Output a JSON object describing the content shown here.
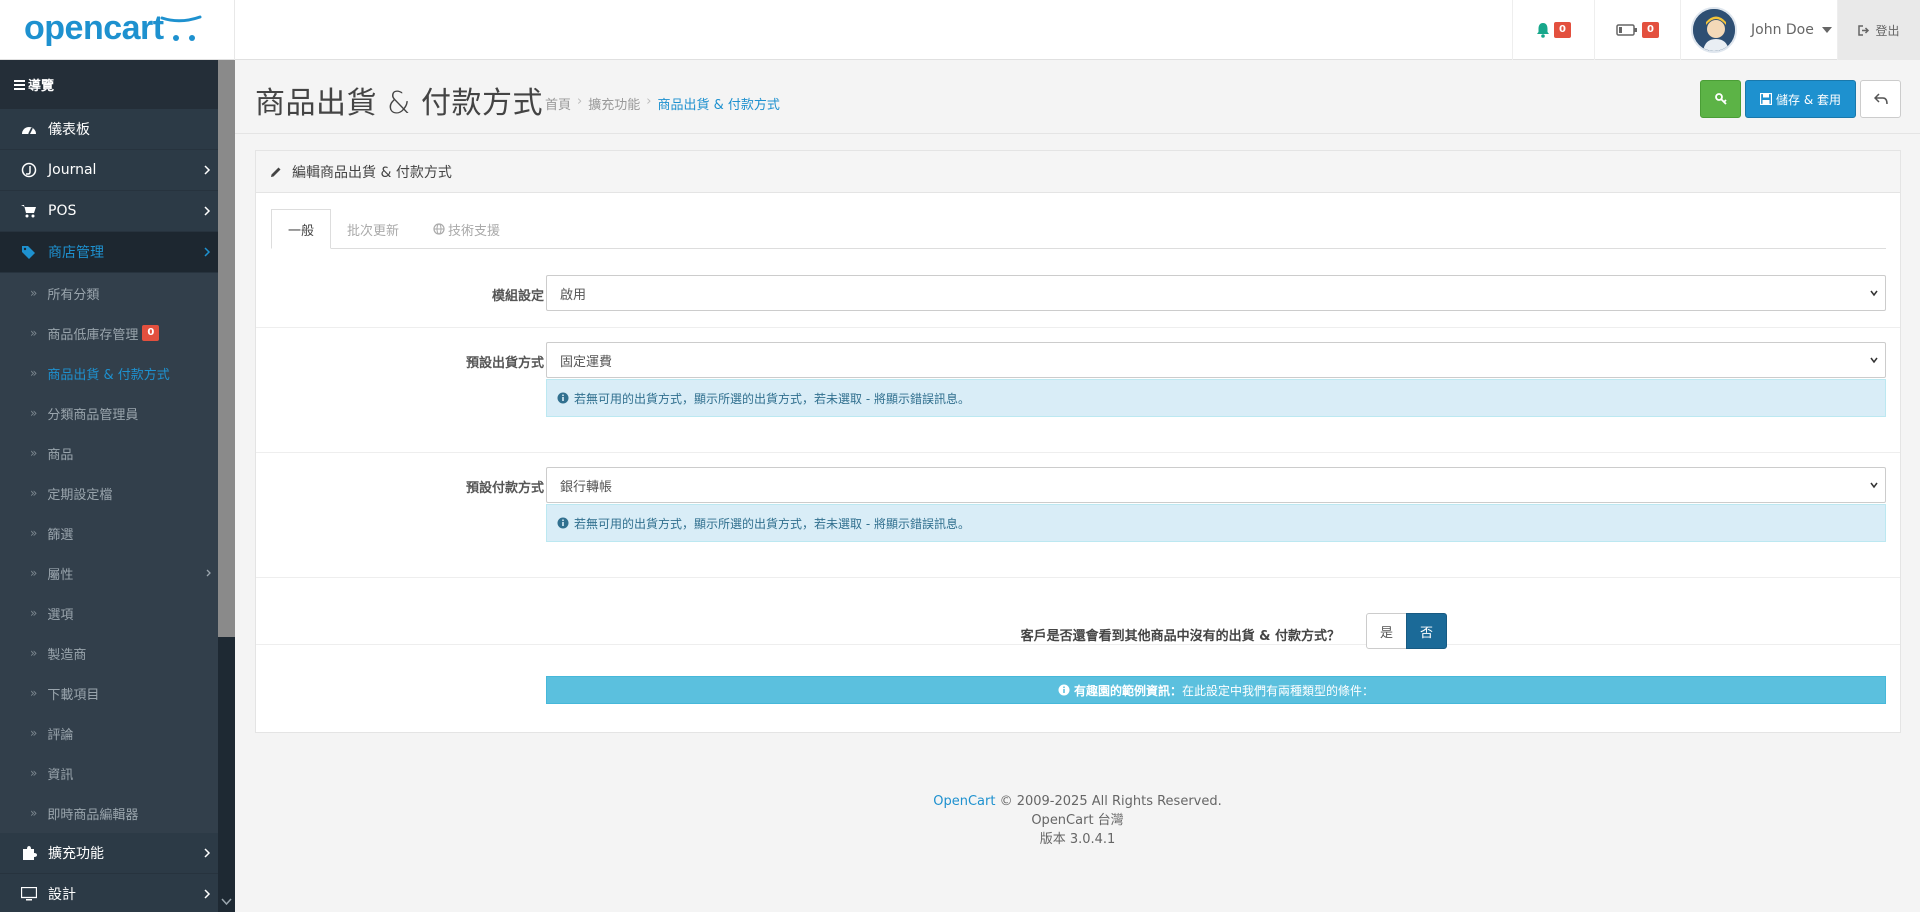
{
  "header": {
    "logo": "opencart",
    "notifications_count": "0",
    "battery_count": "0",
    "user_name": "John Doe",
    "logout_label": "登出"
  },
  "sidebar": {
    "nav_label": "導覽",
    "items": [
      {
        "label": "儀表板",
        "icon": "dashboard-icon"
      },
      {
        "label": "Journal",
        "icon": "journal-icon"
      },
      {
        "label": "POS",
        "icon": "cart-icon"
      },
      {
        "label": "商店管理",
        "icon": "tags-icon"
      }
    ],
    "sub_items": [
      {
        "label": "所有分類"
      },
      {
        "label": "商品低庫存管理",
        "badge": "0"
      },
      {
        "label": "商品出貨 & 付款方式"
      },
      {
        "label": "分類商品管理員"
      },
      {
        "label": "商品"
      },
      {
        "label": "定期設定檔"
      },
      {
        "label": "篩選"
      },
      {
        "label": "屬性"
      },
      {
        "label": "選項"
      },
      {
        "label": "製造商"
      },
      {
        "label": "下載項目"
      },
      {
        "label": "評論"
      },
      {
        "label": "資訊"
      },
      {
        "label": "即時商品編輯器"
      }
    ],
    "bottom_items": [
      {
        "label": "擴充功能",
        "icon": "puzzle-icon"
      },
      {
        "label": "設計",
        "icon": "monitor-icon"
      }
    ]
  },
  "page": {
    "title": "商品出貨 & 付款方式",
    "breadcrumb": [
      "首頁",
      "擴充功能",
      "商品出貨 & 付款方式"
    ],
    "save_label": "儲存 & 套用"
  },
  "panel": {
    "heading": "編輯商品出貨 & 付款方式",
    "tabs": [
      "一般",
      "批次更新",
      "技術支援"
    ],
    "module_label": "模組設定",
    "module_value": "啟用",
    "shipping_label": "預設出貨方式",
    "shipping_value": "固定運費",
    "shipping_help": "若無可用的出貨方式，顯示所選的出貨方式，若未選取 - 將顯示錯誤訊息。",
    "payment_label": "預設付款方式",
    "payment_value": "銀行轉帳",
    "payment_help": "若無可用的出貨方式，顯示所選的出貨方式，若未選取 - 將顯示錯誤訊息。",
    "toggle_question": "客戶是否還會看到其他商品中沒有的出貨 & 付款方式？",
    "toggle_yes": "是",
    "toggle_no": "否",
    "info_bold": "有趣園的範例資訊：",
    "info_text": "在此設定中我們有兩種類型的條件："
  },
  "footer": {
    "brand": "OpenCart",
    "copyright": "© 2009-2025 All Rights Reserved.",
    "line2": "OpenCart 台灣",
    "version": "版本 3.0.4.1"
  },
  "colors": {
    "accent": "#1e91cf",
    "sidebar_bg": "#2c3a46",
    "badge": "#e3503e",
    "success": "#5cb346"
  }
}
